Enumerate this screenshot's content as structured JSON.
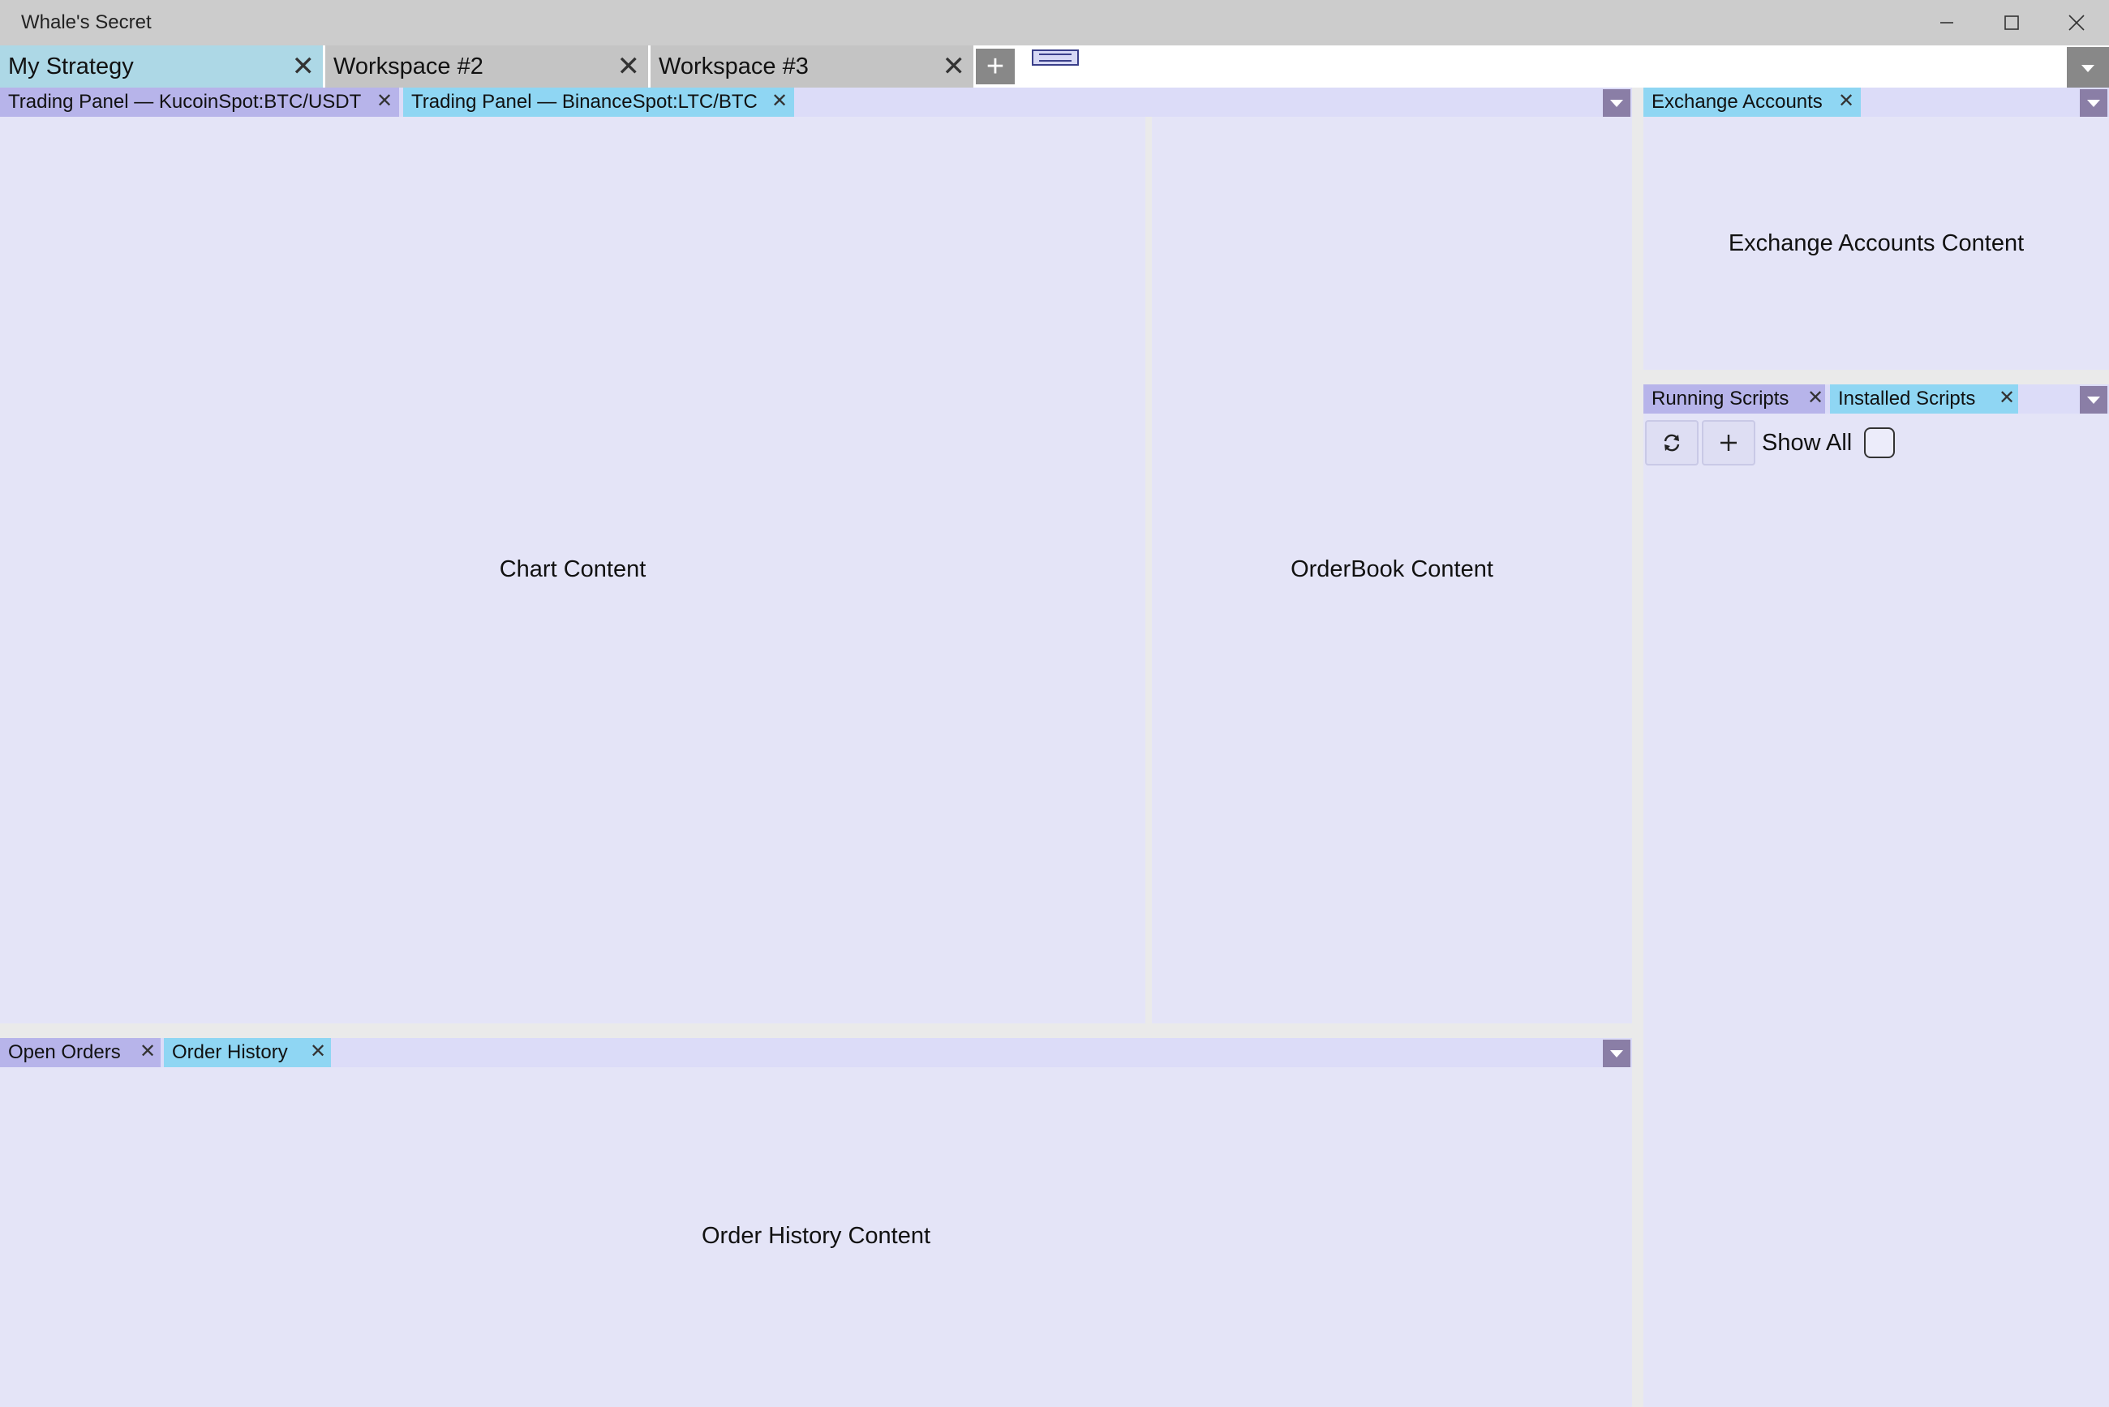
{
  "window": {
    "title": "Whale's Secret",
    "minimize_icon": "minimize-icon",
    "maximize_icon": "maximize-icon",
    "close_icon": "close-icon"
  },
  "workspaces": {
    "tabs": [
      {
        "label": "My Strategy",
        "active": true
      },
      {
        "label": "Workspace #2",
        "active": false
      },
      {
        "label": "Workspace #3",
        "active": false
      }
    ],
    "add_icon": "plus-icon",
    "close_glyph": "✕",
    "add_glyph": "+"
  },
  "trading_panel": {
    "tabs": [
      {
        "label": "Trading Panel — KucoinSpot:BTC/USDT"
      },
      {
        "label": "Trading Panel — BinanceSpot:LTC/BTC"
      }
    ],
    "chart_content": "Chart Content",
    "orderbook_content": "OrderBook Content"
  },
  "exchange_accounts": {
    "tab_label": "Exchange Accounts",
    "content": "Exchange Accounts Content"
  },
  "scripts": {
    "tabs": [
      {
        "label": "Running Scripts"
      },
      {
        "label": "Installed Scripts"
      }
    ],
    "refresh_icon": "refresh-icon",
    "add_icon": "plus-icon",
    "show_all_label": "Show All",
    "show_all_checked": false
  },
  "orders": {
    "tabs": [
      {
        "label": "Open Orders"
      },
      {
        "label": "Order History"
      }
    ],
    "content": "Order History Content"
  },
  "colors": {
    "tab_purple": "#b7b4ea",
    "tab_blue": "#8fd6f3",
    "panel_background": "#e4e4f7",
    "workspace_active": "#add8e6",
    "workspace_inactive": "#c4c4c4",
    "title_bar": "#cccccc"
  }
}
